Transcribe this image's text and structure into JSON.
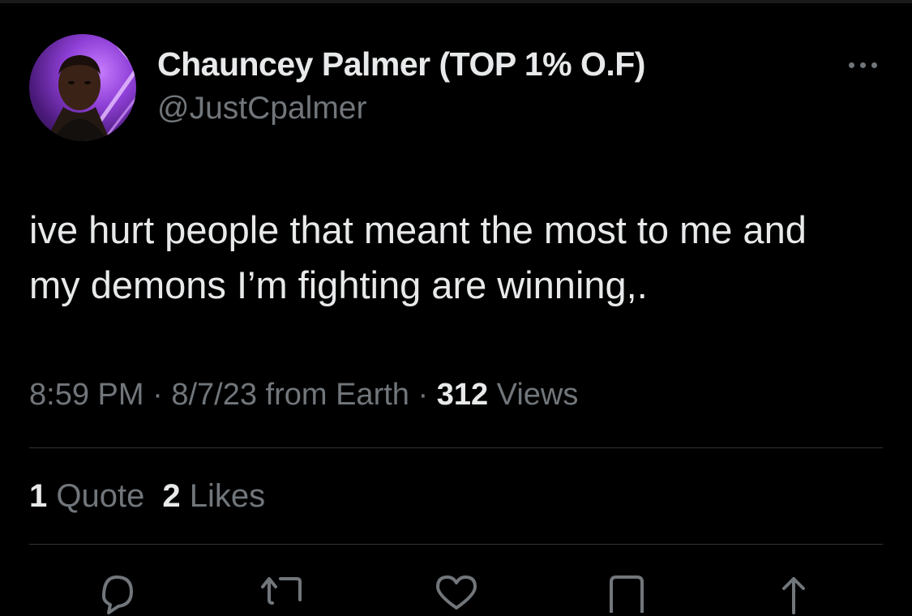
{
  "author": {
    "display_name": "Chauncey Palmer (TOP 1% O.F)",
    "handle": "@JustCpalmer"
  },
  "tweet": {
    "text": "ive hurt people that meant the most to me and\nmy demons I’m fighting are winning,."
  },
  "meta": {
    "time": "8:59 PM",
    "sep1": " · ",
    "date": "8/7/23",
    "source": " from Earth",
    "sep2": " · ",
    "views_count": "312",
    "views_label": " Views"
  },
  "stats": {
    "quotes_count": "1",
    "quotes_label": " Quote",
    "likes_count": "2",
    "likes_label": " Likes"
  },
  "icons": {
    "more": "more-icon",
    "reply": "reply-icon",
    "retweet": "retweet-icon",
    "like": "heart-icon",
    "bookmark": "bookmark-icon",
    "share": "share-icon"
  },
  "colors": {
    "background": "#000000",
    "primary_text": "#e7e9ea",
    "secondary_text": "#71767b",
    "divider": "#2f3336"
  }
}
